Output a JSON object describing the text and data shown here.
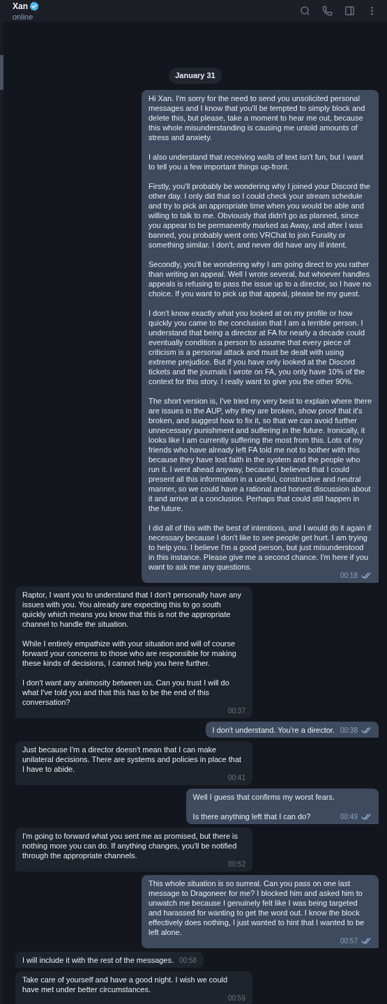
{
  "header": {
    "name": "Xan",
    "verified": true,
    "status": "online"
  },
  "date": "January 31",
  "messages": [
    {
      "kind": "outgoing",
      "text": "Hi Xan. I'm sorry for the need to send you unsolicited personal messages and I know that you'll be tempted to simply block and delete this, but please, take a moment to hear me out, because this whole misunderstanding is causing me untold amounts of stress and anxiety.\n\nI also understand that receiving walls of text isn't fun, but I want to tell you a few important things up-front.\n\nFirstly, you'll probably be wondering why I joined your Discord the other day. I only did that so I could check your stream schedule and try to pick an appropriate time when you would be able and willing to talk to me. Obviously that didn't go as planned, since you appear to be permanently marked as Away, and after I was banned, you probably went onto VRChat to join Furality or something similar. I don't, and never did have any ill intent.\n\nSecondly, you'll be wondering why I am going direct to you rather than writing an appeal. Well I wrote several, but whoever handles appeals is refusing to pass the issue up to a director, so I have no choice. If you want to pick up that appeal, please be my guest.\n\nI don't know exactly what you looked at on my profile or how quickly you came to the conclusion that I am a terrible person. I understand that being a director at FA for nearly a decade could eventually condition a person to assume that every piece of criticism is a personal attack and must be dealt with using extreme prejudice. But if you have only looked at the Discord tickets and the journals I wrote on FA, you only have 10% of the context for this story. I really want to give you the other 90%.\n\nThe short version is, I've tried my very best to explain where there are issues in the AUP, why they are broken, show proof that it's broken, and suggest how to fix it, so that we can avoid further unnecessary punishment and suffering in the future. Ironically, it looks like I am currently suffering the most from this. Lots of my friends who have already left FA told me not to bother with this because they have lost faith in the system and the people who run it. I went ahead anyway, because I believed that I could present all this information in a useful, constructive and neutral manner, so we could have a rational and honest discussion about it and arrive at a conclusion. Perhaps that could still happen in the future.\n\nI did all of this with the best of intentions, and I would do it again if necessary because I don't like to see people get hurt. I am trying to help you. I believe I'm a good person, but just misunderstood in this instance. Please give me a second chance. I'm here if you want to ask me any questions.",
      "time": "00:18",
      "read": true
    },
    {
      "kind": "incoming",
      "text": "Raptor, I want you to understand that I don't personally have any issues with you. You already are expecting this to go south quickly which means you know that this is not the appropriate channel to handle the situation.\n\nWhile I entirely empathize with your situation and will of course forward your concerns to those who are responsible for making these kinds of decisions, I cannot help you here further.\n\nI don't want any animosity between us. Can you trust I will do what I've told you and that this has to be the end of this conversation?",
      "time": "00:37"
    },
    {
      "kind": "outgoing",
      "text": "I don't understand. You're a director.",
      "time": "00:38",
      "read": true
    },
    {
      "kind": "incoming",
      "text": "Just because I'm a director doesn't mean that I can make unilateral decisions. There are systems and policies in place that I have to abide.",
      "time": "00:41"
    },
    {
      "kind": "outgoing",
      "text": "Well I guess that confirms my worst fears.\n\nIs there anything left that I can do?",
      "time": "00:49",
      "read": true
    },
    {
      "kind": "incoming",
      "text": "I'm going to forward what you sent me as promised, but there is nothing more you can do. If anything changes, you'll be notified through the appropriate channels.",
      "time": "00:52"
    },
    {
      "kind": "outgoing",
      "text": "This whole situation is so surreal. Can you pass on one last message to Dragoneer for me? I blocked him and asked him to unwatch me because I genuinely felt like I was being targeted and harassed for wanting to get the word out. I know the block effectively does nothing, I just wanted to hint that I wanted to be left alone.",
      "time": "00:57",
      "read": true
    },
    {
      "kind": "incoming",
      "text": "I will include it with the rest of the messages.",
      "time": "00:58"
    },
    {
      "kind": "incoming",
      "text": "Take care of yourself and have a good night. I wish we could have met under better circumstances.",
      "time": "00:59"
    }
  ]
}
